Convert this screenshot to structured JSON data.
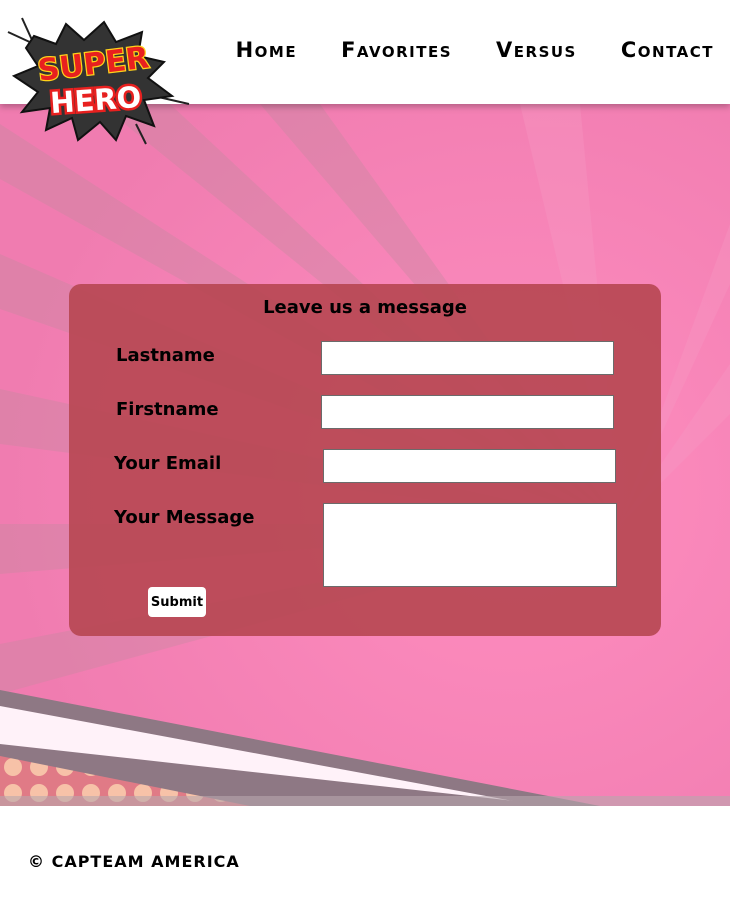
{
  "logo": {
    "line1": "SUPER",
    "line2": "HERO"
  },
  "nav": {
    "items": [
      {
        "label": "Home"
      },
      {
        "label": "Favorites"
      },
      {
        "label": "Versus"
      },
      {
        "label": "Contact"
      }
    ]
  },
  "form": {
    "title": "Leave us a message",
    "lastname_label": "Lastname",
    "lastname_value": "",
    "firstname_label": "Firstname",
    "firstname_value": "",
    "email_label": "Your Email",
    "email_value": "",
    "message_label": "Your Message",
    "message_value": "",
    "submit_label": "Submit"
  },
  "footer": {
    "copyright": "© CAPTEAM AMERICA"
  },
  "colors": {
    "background_pink": "#f783b4",
    "form_panel": "#b84854",
    "logo_red": "#e8201f",
    "logo_yellow": "#ffd21a",
    "logo_dark": "#333333"
  }
}
